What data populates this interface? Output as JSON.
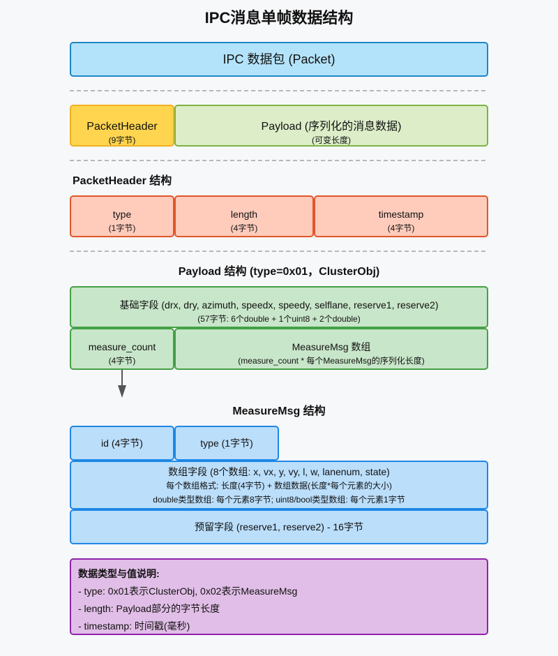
{
  "title": "IPC消息单帧数据结构",
  "packet": {
    "label": "IPC 数据包 (Packet)"
  },
  "header_box": {
    "label": "PacketHeader",
    "size": "(9字节)"
  },
  "payload_box": {
    "label": "Payload (序列化的消息数据)",
    "size": "(可变长度)"
  },
  "packet_header_section": {
    "title": "PacketHeader 结构",
    "fields": [
      {
        "name": "type",
        "size": "(1字节)"
      },
      {
        "name": "length",
        "size": "(4字节)"
      },
      {
        "name": "timestamp",
        "size": "(4字节)"
      }
    ]
  },
  "payload_section": {
    "title": "Payload 结构 (type=0x01，ClusterObj)",
    "base_fields": {
      "label": "基础字段 (drx, dry, azimuth, speedx, speedy, selflane, reserve1, reserve2)",
      "size": "(57字节: 6个double + 1个uint8 + 2个double)"
    },
    "measure_count": {
      "label": "measure_count",
      "size": "(4字节)"
    },
    "measure_array": {
      "label": "MeasureMsg 数组",
      "size": "(measure_count * 每个MeasureMsg的序列化长度)"
    }
  },
  "measure_section": {
    "title": "MeasureMsg 结构",
    "id_field": "id (4字节)",
    "type_field": "type (1字节)",
    "array_fields": {
      "label": "数组字段 (8个数组: x, vx, y, vy, l, w, lanenum, state)",
      "line1": "每个数组格式: 长度(4字节) + 数组数据(长度*每个元素的大小)",
      "line2": "double类型数组: 每个元素8字节; uint8/bool类型数组: 每个元素1字节"
    },
    "reserved": "预留字段 (reserve1, reserve2) - 16字节"
  },
  "notes": {
    "title": "数据类型与值说明:",
    "lines": [
      "- type: 0x01表示ClusterObj, 0x02表示MeasureMsg",
      "- length: Payload部分的字节长度",
      "- timestamp: 时间戳(毫秒)"
    ]
  },
  "colors": {
    "packet": "#b3e3fa",
    "header": "#ffd54f",
    "payload": "#dcedc8",
    "header_fields": "#ffccbc",
    "payload_fields": "#c8e6c9",
    "measure_fields": "#bbdefb",
    "notes": "#e1bee7"
  }
}
